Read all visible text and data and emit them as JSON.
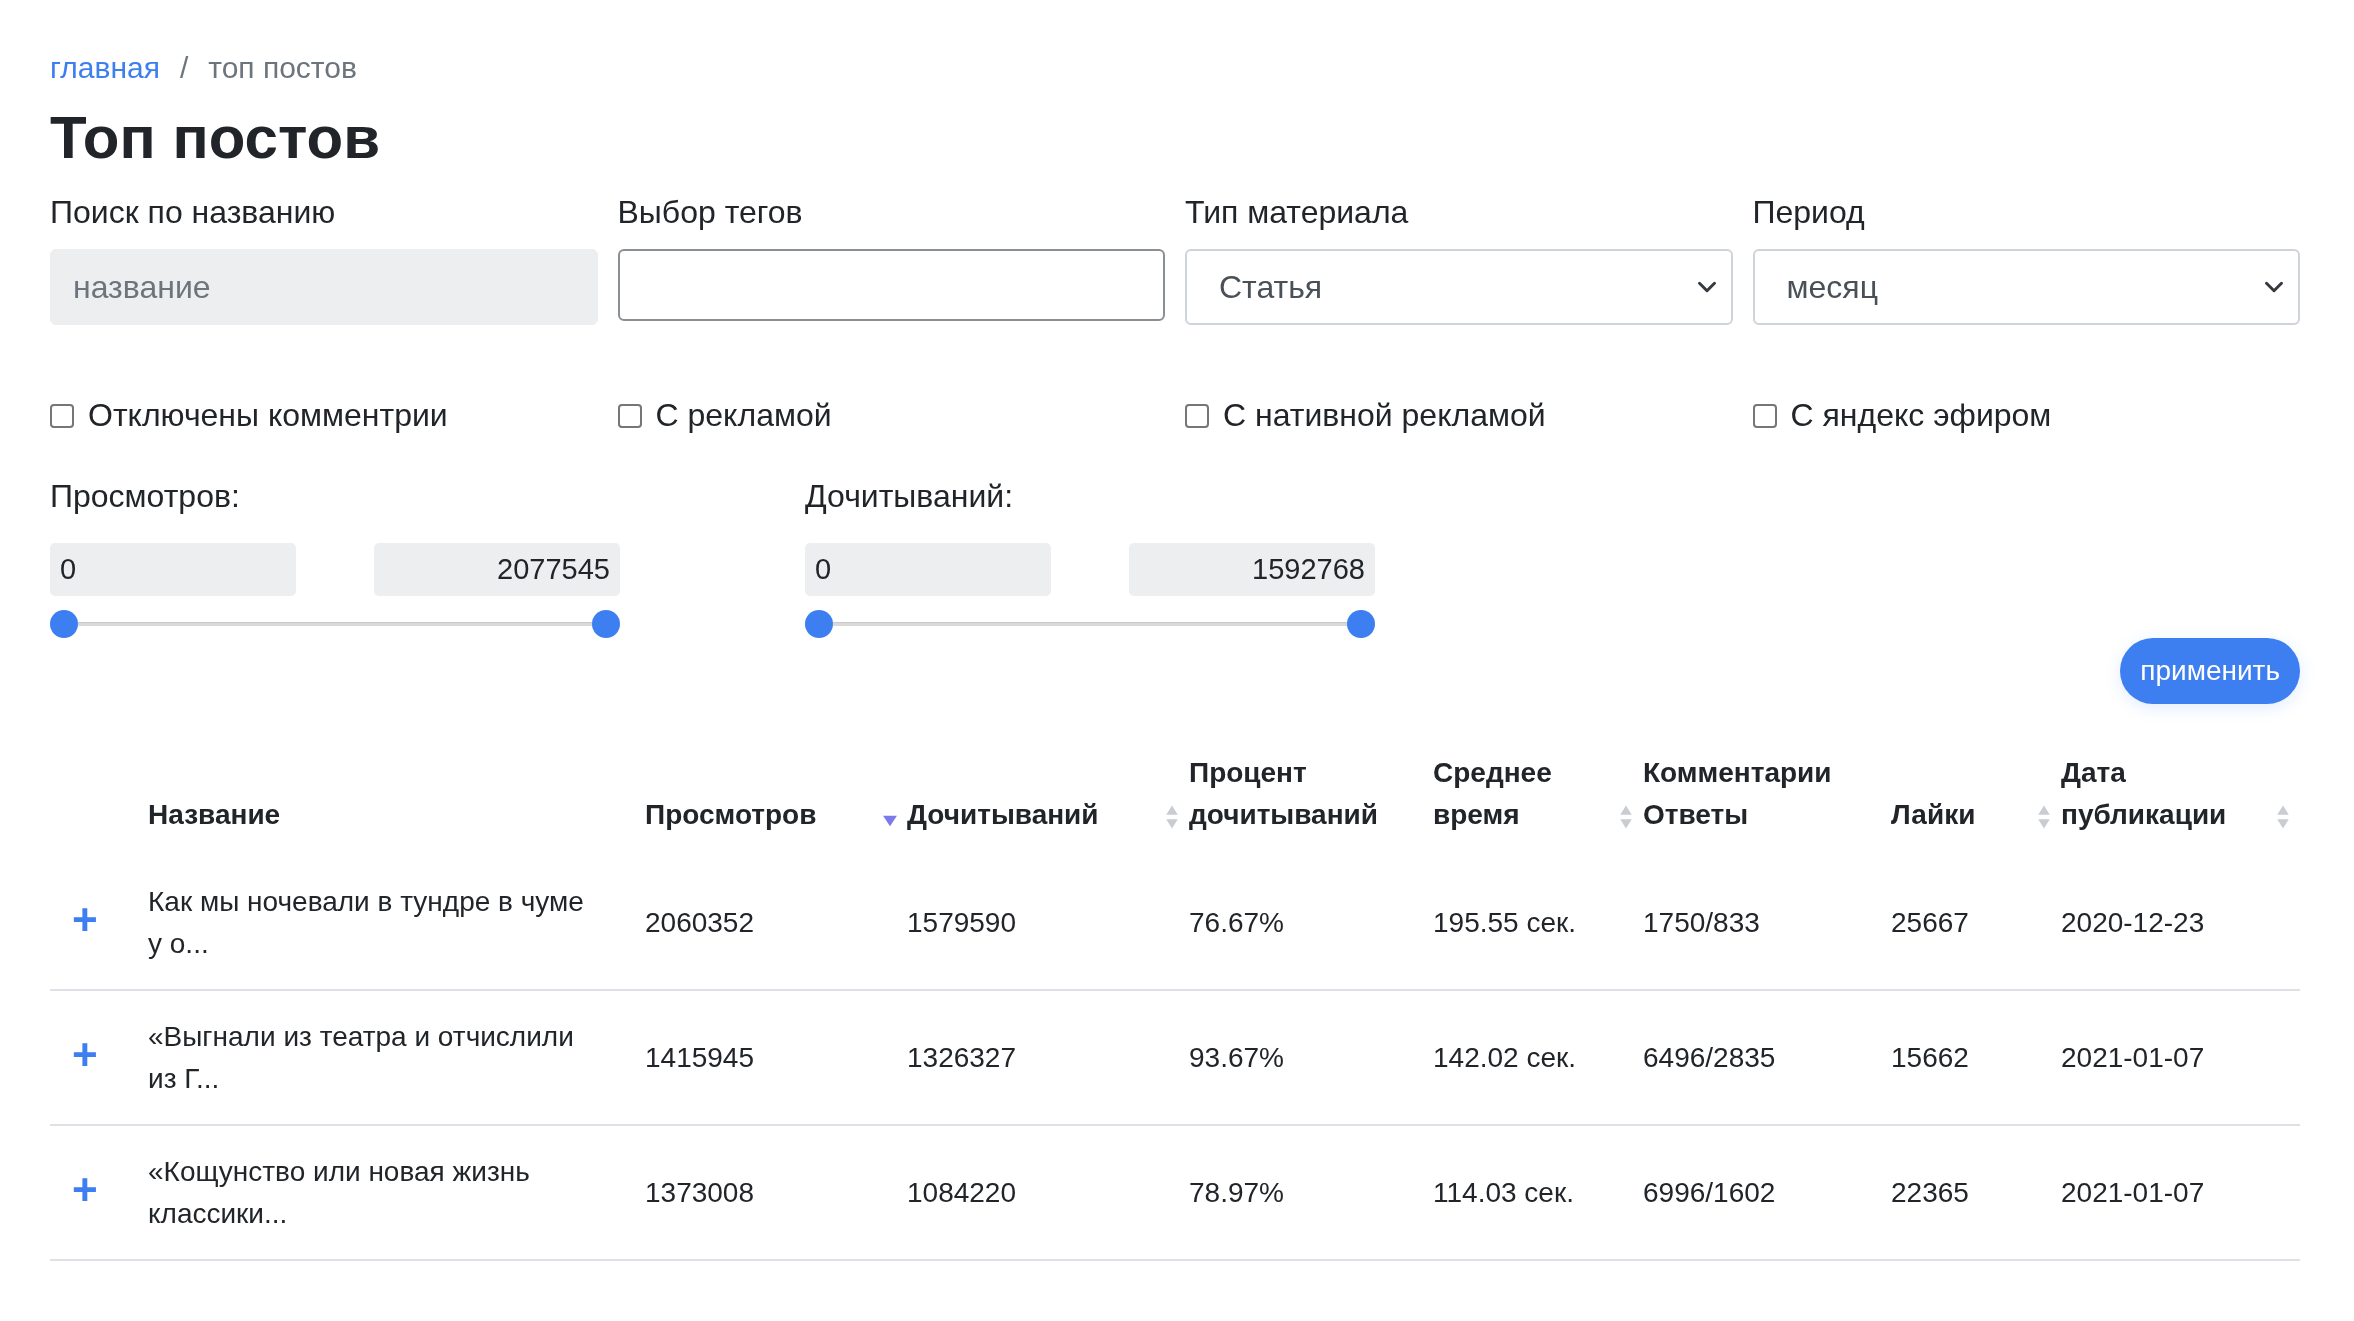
{
  "breadcrumb": [
    {
      "label": "главная",
      "kind": "link"
    },
    {
      "label": "топ постов",
      "kind": "current"
    }
  ],
  "breadcrumb_separator": "/",
  "title": "Топ постов",
  "filters": [
    {
      "kind": "search",
      "label": "Поиск по названию",
      "placeholder": "название"
    },
    {
      "kind": "text",
      "label": "Выбор тегов"
    },
    {
      "kind": "select",
      "label": "Тип материала",
      "value": "Статья"
    },
    {
      "kind": "select",
      "label": "Период",
      "value": "месяц"
    }
  ],
  "checkboxes": [
    {
      "label": "Отключены комментрии",
      "checked": false
    },
    {
      "label": "С рекламой",
      "checked": false
    },
    {
      "label": "С нативной рекламой",
      "checked": false
    },
    {
      "label": "С яндекс эфиром",
      "checked": false
    }
  ],
  "ranges": [
    {
      "label": "Просмотров:",
      "min_value": "0",
      "max_value": "2077545",
      "min_thumb": {
        "level": 0
      },
      "max_thumb": {
        "level": 1
      }
    },
    {
      "label": "Дочитываний:",
      "min_value": "0",
      "max_value": "1592768",
      "min_thumb": {
        "level": 0
      },
      "max_thumb": {
        "level": 1
      }
    }
  ],
  "apply_button": "применить",
  "table": {
    "columns": [
      {
        "label": "Название",
        "sortable": false,
        "sorted_descending": false
      },
      {
        "label": "Просмотров",
        "sortable": true,
        "sorted_descending": true
      },
      {
        "label": "Дочитываний",
        "sortable": true,
        "sorted_descending": false
      },
      {
        "label": "Процент дочитываний",
        "sortable": false,
        "sorted_descending": false
      },
      {
        "label": "Среднее время",
        "sortable": true,
        "sorted_descending": false
      },
      {
        "label": "Комментарии Ответы",
        "sortable": false,
        "sorted_descending": false
      },
      {
        "label": "Лайки",
        "sortable": true,
        "sorted_descending": false
      },
      {
        "label": "Дата публикации",
        "sortable": true,
        "sorted_descending": false
      }
    ],
    "rows": [
      {
        "expand": "+",
        "cells": [
          "Как мы ночевали в тундре в чуме у о...",
          "2060352",
          "1579590",
          "76.67%",
          "195.55 сек.",
          "1750/833",
          "25667",
          "2020-12-23"
        ]
      },
      {
        "expand": "+",
        "cells": [
          "«Выгнали из театра и отчислили из Г...",
          "1415945",
          "1326327",
          "93.67%",
          "142.02 сек.",
          "6496/2835",
          "15662",
          "2021-01-07"
        ]
      },
      {
        "expand": "+",
        "cells": [
          "«Кощунство или новая жизнь классики...",
          "1373008",
          "1084220",
          "78.97%",
          "114.03 сек.",
          "6996/1602",
          "22365",
          "2021-01-07"
        ]
      }
    ]
  }
}
